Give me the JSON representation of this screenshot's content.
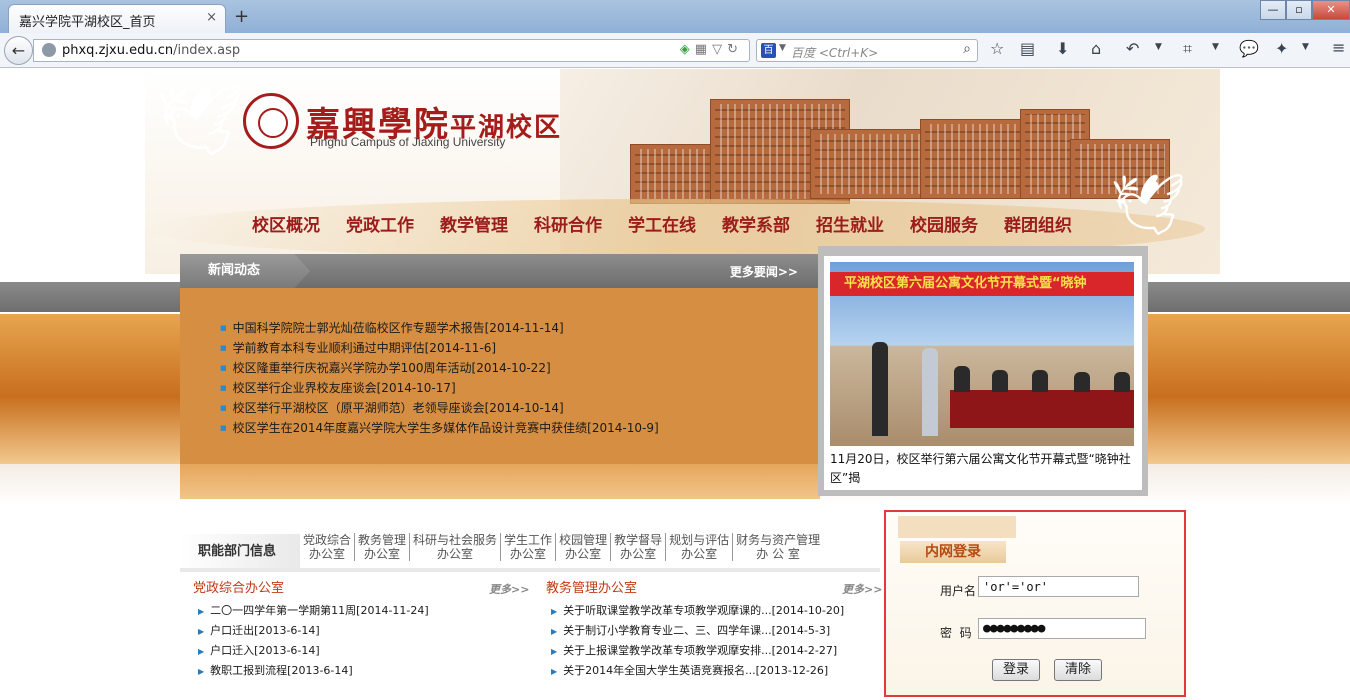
{
  "browser": {
    "tab_title": "嘉兴学院平湖校区_首页",
    "tab_close": "×",
    "new_tab": "+",
    "url_host": "phxq.zjxu.edu.cn",
    "url_path": "/index.asp",
    "search_placeholder": "百度 <Ctrl+K>",
    "search_engine": "百",
    "icons": [
      "back-icon",
      "globe-icon",
      "shield-icon",
      "qr-icon",
      "reload-icon",
      "bookmark-star-icon",
      "reading-list-icon",
      "download-icon",
      "home-icon",
      "undo-icon",
      "crop-icon",
      "chat-icon",
      "extension-icon",
      "menu-icon"
    ]
  },
  "header": {
    "title_main": "嘉興學院",
    "title_campus": "平湖校区",
    "subtitle": "Pinghu Campus of Jiaxing University"
  },
  "nav": [
    "校区概况",
    "党政工作",
    "教学管理",
    "科研合作",
    "学工在线",
    "教学系部",
    "招生就业",
    "校园服务",
    "群团组织"
  ],
  "news": {
    "title": "新闻动态",
    "more": "更多要闻>>",
    "items": [
      "中国科学院院士郭光灿莅临校区作专题学术报告[2014-11-14]",
      "学前教育本科专业顺利通过中期评估[2014-11-6]",
      "校区隆重举行庆祝嘉兴学院办学100周年活动[2014-10-22]",
      "校区举行企业界校友座谈会[2014-10-17]",
      "校区举行平湖校区（原平湖师范）老领导座谈会[2014-10-14]",
      "校区学生在2014年度嘉兴学院大学生多媒体作品设计竞赛中获佳绩[2014-10-9]"
    ]
  },
  "photo": {
    "banner": "平湖校区第六届公寓文化节开幕式暨“晓钟",
    "caption": "11月20日，校区举行第六届公寓文化节开幕式暨“晓钟社区”揭"
  },
  "departments": {
    "label": "职能部门信息",
    "tabs": [
      [
        "党政综合",
        "办公室"
      ],
      [
        "教务管理",
        "办公室"
      ],
      [
        "科研与社会服务",
        "办公室"
      ],
      [
        "学生工作",
        "办公室"
      ],
      [
        "校园管理",
        "办公室"
      ],
      [
        "教学督导",
        "办公室"
      ],
      [
        "规划与评估",
        "办公室"
      ],
      [
        "财务与资产管理",
        "办 公 室"
      ]
    ],
    "left": {
      "title": "党政综合办公室",
      "more": "更多>>",
      "items": [
        "二〇一四学年第一学期第11周[2014-11-24]",
        "户口迁出[2013-6-14]",
        "户口迁入[2013-6-14]",
        "教职工报到流程[2013-6-14]"
      ]
    },
    "right": {
      "title": "教务管理办公室",
      "more": "更多>>",
      "items": [
        "关于听取课堂教学改革专项教学观摩课的...[2014-10-20]",
        "关于制订小学教育专业二、三、四学年课...[2014-5-3]",
        "关于上报课堂教学改革专项教学观摩安排...[2014-2-27]",
        "关于2014年全国大学生英语竞赛报名...[2013-12-26]"
      ]
    }
  },
  "login": {
    "title": "内网登录",
    "username_label": "用户名",
    "username_value": "'or'='or'",
    "password_label": "密  码",
    "password_value": "●●●●●●●●●",
    "login_button": "登录",
    "clear_button": "清除",
    "highlight_color": "#e23a3a"
  }
}
